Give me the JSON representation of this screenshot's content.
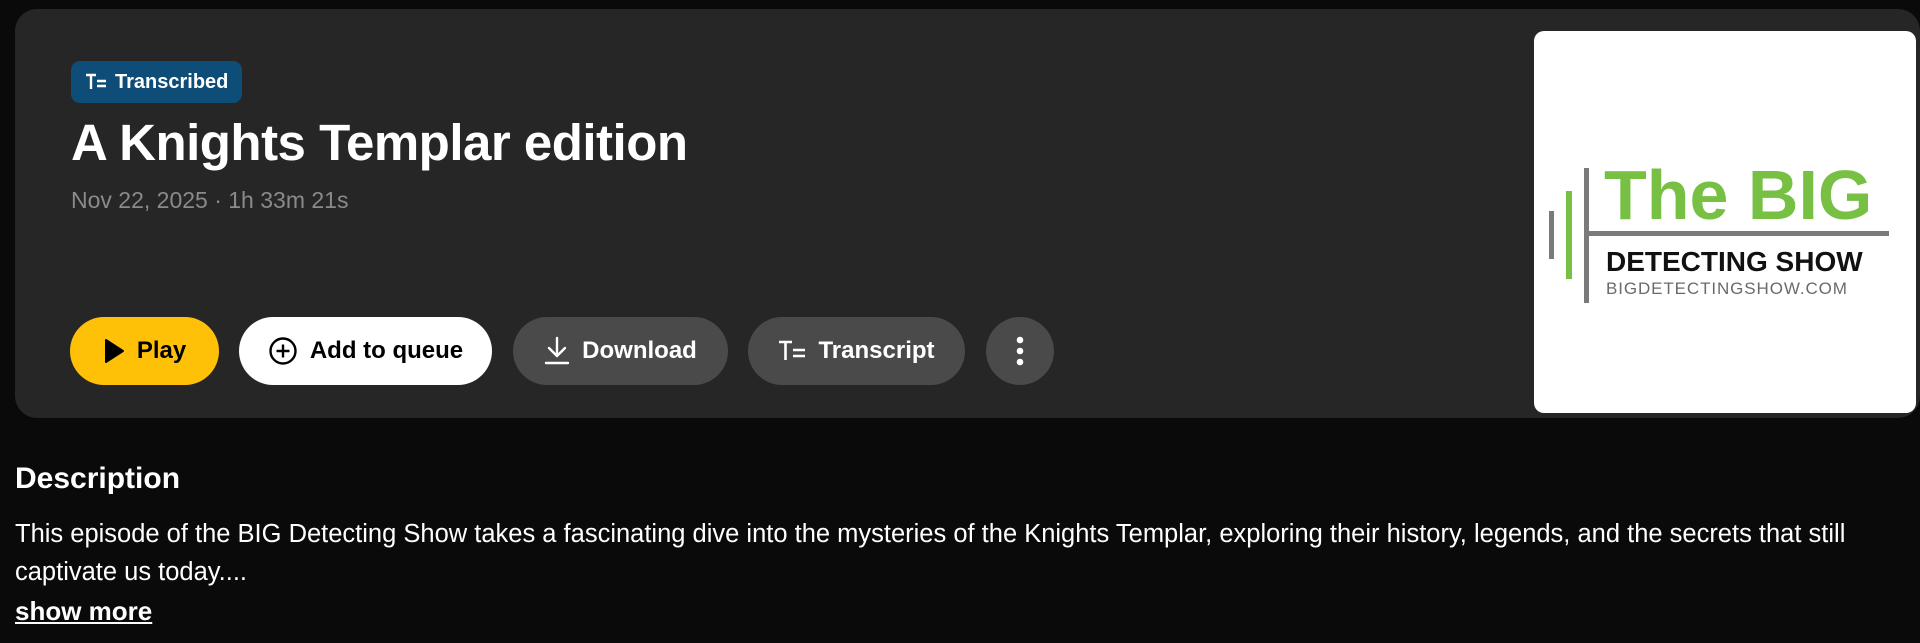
{
  "episode": {
    "badge_label": "Transcribed",
    "badge_icon": "transcript-icon",
    "title": "A Knights Templar edition",
    "meta": "Nov 22, 2025 · 1h 33m 21s"
  },
  "actions": {
    "play_label": "Play",
    "queue_label": "Add to queue",
    "download_label": "Download",
    "transcript_label": "Transcript"
  },
  "artwork": {
    "line1": "The BIG",
    "line2": "DETECTING SHOW",
    "line3": "BIGDETECTINGSHOW.COM"
  },
  "description": {
    "heading": "Description",
    "text": "This episode of the  BIG Detecting Show takes a fascinating dive into the mysteries of the Knights Templar, exploring their history, legends, and the secrets that still captivate us today....",
    "show_more_label": "show more"
  },
  "colors": {
    "background": "#0a0a0a",
    "card": "#262626",
    "badge": "#0f4d79",
    "play": "#ffc107",
    "secondary_button": "#4a4a4a",
    "brand_green": "#77c043"
  }
}
